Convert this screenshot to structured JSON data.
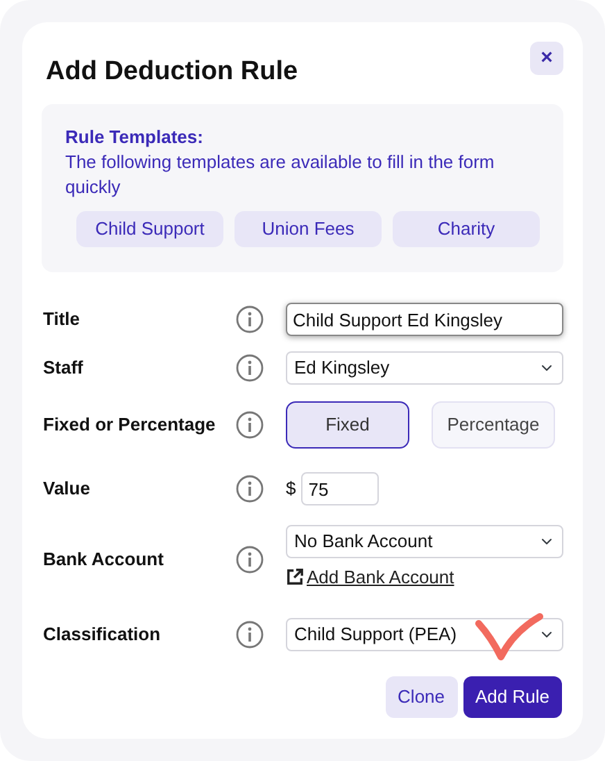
{
  "dialog": {
    "title": "Add Deduction Rule",
    "close": "×"
  },
  "templates": {
    "heading": "Rule Templates:",
    "description": "The following templates are available to fill in the form quickly",
    "buttons": [
      "Child Support",
      "Union Fees",
      "Charity"
    ]
  },
  "fields": [
    {
      "label": "Title",
      "kind": "text",
      "value": "Child Support Ed Kingsley",
      "focused": true
    },
    {
      "label": "Staff",
      "kind": "select",
      "value": "Ed Kingsley"
    },
    {
      "label": "Fixed or Percentage",
      "kind": "toggle",
      "options": [
        {
          "label": "Fixed",
          "selected": true
        },
        {
          "label": "Percentage",
          "selected": false
        }
      ]
    },
    {
      "label": "Value",
      "kind": "money",
      "prefix": "$",
      "value": "75"
    },
    {
      "label": "Bank Account",
      "kind": "select",
      "value": "No Bank Account",
      "link": "Add Bank Account"
    },
    {
      "label": "Classification",
      "kind": "select",
      "value": "Child Support (PEA)"
    }
  ],
  "buttons": [
    {
      "label": "Clone",
      "kind": "secondary"
    },
    {
      "label": "Add Rule",
      "kind": "primary"
    }
  ]
}
